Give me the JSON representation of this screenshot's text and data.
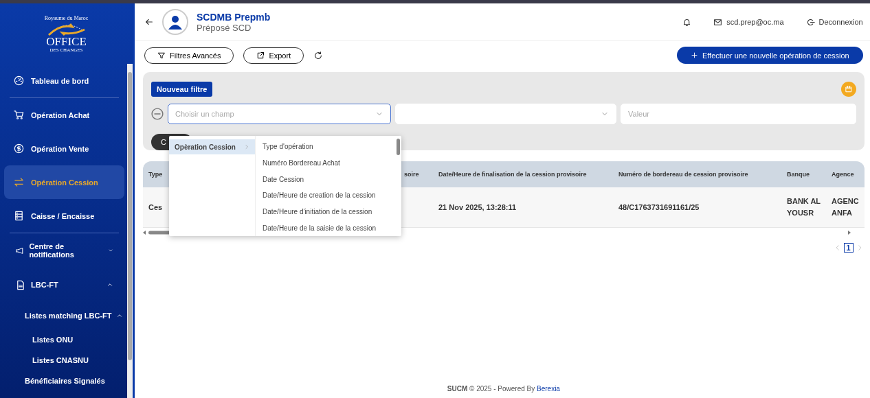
{
  "logo": {
    "kingdom": "Royaume du Maroc",
    "name": "OFFICE",
    "subname": "DES CHANGES"
  },
  "sidebar": {
    "items": [
      {
        "kind": "item",
        "label": "Tableau de bord",
        "selected": false,
        "divider": true
      },
      {
        "kind": "item",
        "label": "Opération Achat",
        "selected": false,
        "divider": false
      },
      {
        "kind": "item",
        "label": "Opération Vente",
        "selected": false,
        "divider": false
      },
      {
        "kind": "item",
        "label": "Opération Cession",
        "selected": true,
        "divider": false
      },
      {
        "kind": "item",
        "label": "Caisse / Encaisse",
        "selected": false,
        "divider": true
      },
      {
        "kind": "group",
        "label": "Centre de notifications",
        "expanded": false
      },
      {
        "kind": "group",
        "label": "LBC-FT",
        "expanded": true
      },
      {
        "kind": "subgroup",
        "label": "Listes matching LBC-FT",
        "expanded": true
      },
      {
        "kind": "leaf",
        "label": "Listes ONU"
      },
      {
        "kind": "leaf",
        "label": "Listes CNASNU"
      },
      {
        "kind": "sub",
        "label": "Bénéficiaires Signalés"
      }
    ]
  },
  "header": {
    "user_name": "SCDMB Prepmb",
    "user_role": "Préposé SCD",
    "email": "scd.prep@oc.ma",
    "logout": "Deconnexion"
  },
  "toolbar": {
    "filters_button": "Filtres Avancés",
    "export_button": "Export",
    "new_button": "Effectuer une nouvelle opération de cession"
  },
  "filter_panel": {
    "new_filter_button": "Nouveau filtre",
    "field_select": {
      "placeholder": "Choisir un champ"
    },
    "value_field": {
      "placeholder": "Valeur"
    },
    "dark_button": "C",
    "dropdown": {
      "categories": [
        {
          "label": "Opèration Cession",
          "selected": true
        }
      ],
      "options": [
        "Type d'opération",
        "Numéro Bordereau Achat",
        "Date Cession",
        "Date/Heure de creation de la cession",
        "Date/Heure d'initiation de la cession",
        "Date/Heure de la saisie de la cession"
      ]
    }
  },
  "table": {
    "columns": [
      "Type",
      "soire",
      "Date/Heure de finalisation de la cession provisoire",
      "Numéro de bordereau de cession provisoire",
      "Banque",
      "Agence"
    ],
    "rows": [
      [
        "Ces",
        "",
        "21 Nov 2025, 13:28:11",
        "48/C1763731691161/25",
        "BANK AL YOUSR",
        "AGENC ANFA"
      ]
    ]
  },
  "pagination": {
    "pages": [
      {
        "label": "1",
        "selected": true
      }
    ]
  },
  "footer": {
    "brand": "SUCM",
    "text": "© 2025 - Powered By",
    "link": "Berexia"
  }
}
